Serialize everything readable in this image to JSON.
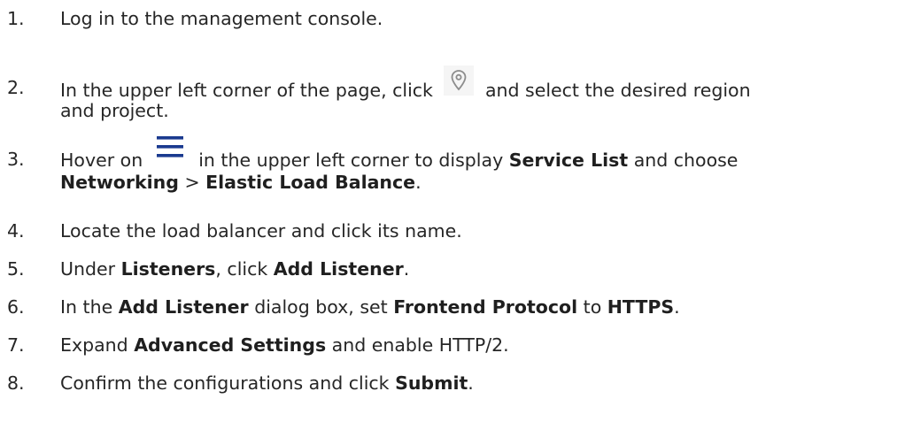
{
  "steps": [
    {
      "num": "1.",
      "parts": [
        {
          "t": "Log in to the management console."
        }
      ]
    },
    {
      "num": "2.",
      "parts": [
        {
          "t": "In the upper left corner of the page, click "
        },
        {
          "icon": "location-pin-icon"
        },
        {
          "t": " and select the desired region"
        }
      ],
      "line2": [
        {
          "t": "and project."
        }
      ]
    },
    {
      "num": "3.",
      "parts": [
        {
          "t": "Hover on "
        },
        {
          "icon": "hamburger-menu-icon"
        },
        {
          "t": " in the upper left corner to display "
        },
        {
          "b": "Service List"
        },
        {
          "t": " and choose"
        }
      ],
      "line2": [
        {
          "b": "Networking"
        },
        {
          "t": " > "
        },
        {
          "b": "Elastic Load Balance"
        },
        {
          "t": "."
        }
      ]
    },
    {
      "num": "4.",
      "parts": [
        {
          "t": "Locate the load balancer and click its name."
        }
      ]
    },
    {
      "num": "5.",
      "parts": [
        {
          "t": "Under "
        },
        {
          "b": "Listeners"
        },
        {
          "t": ", click "
        },
        {
          "b": "Add Listener"
        },
        {
          "t": "."
        }
      ]
    },
    {
      "num": "6.",
      "parts": [
        {
          "t": "In the "
        },
        {
          "b": "Add Listener"
        },
        {
          "t": " dialog box, set "
        },
        {
          "b": "Frontend Protocol"
        },
        {
          "t": " to "
        },
        {
          "b": "HTTPS"
        },
        {
          "t": "."
        }
      ]
    },
    {
      "num": "7.",
      "parts": [
        {
          "t": "Expand "
        },
        {
          "b": "Advanced Settings"
        },
        {
          "t": " and enable HTTP/2."
        }
      ]
    },
    {
      "num": "8.",
      "parts": [
        {
          "t": "Confirm the configurations and click "
        },
        {
          "b": "Submit"
        },
        {
          "t": "."
        }
      ]
    }
  ],
  "colors": {
    "text": "#262626",
    "icon_gray": "#8c8c8c",
    "menu_icon": "#1a3a8f"
  }
}
